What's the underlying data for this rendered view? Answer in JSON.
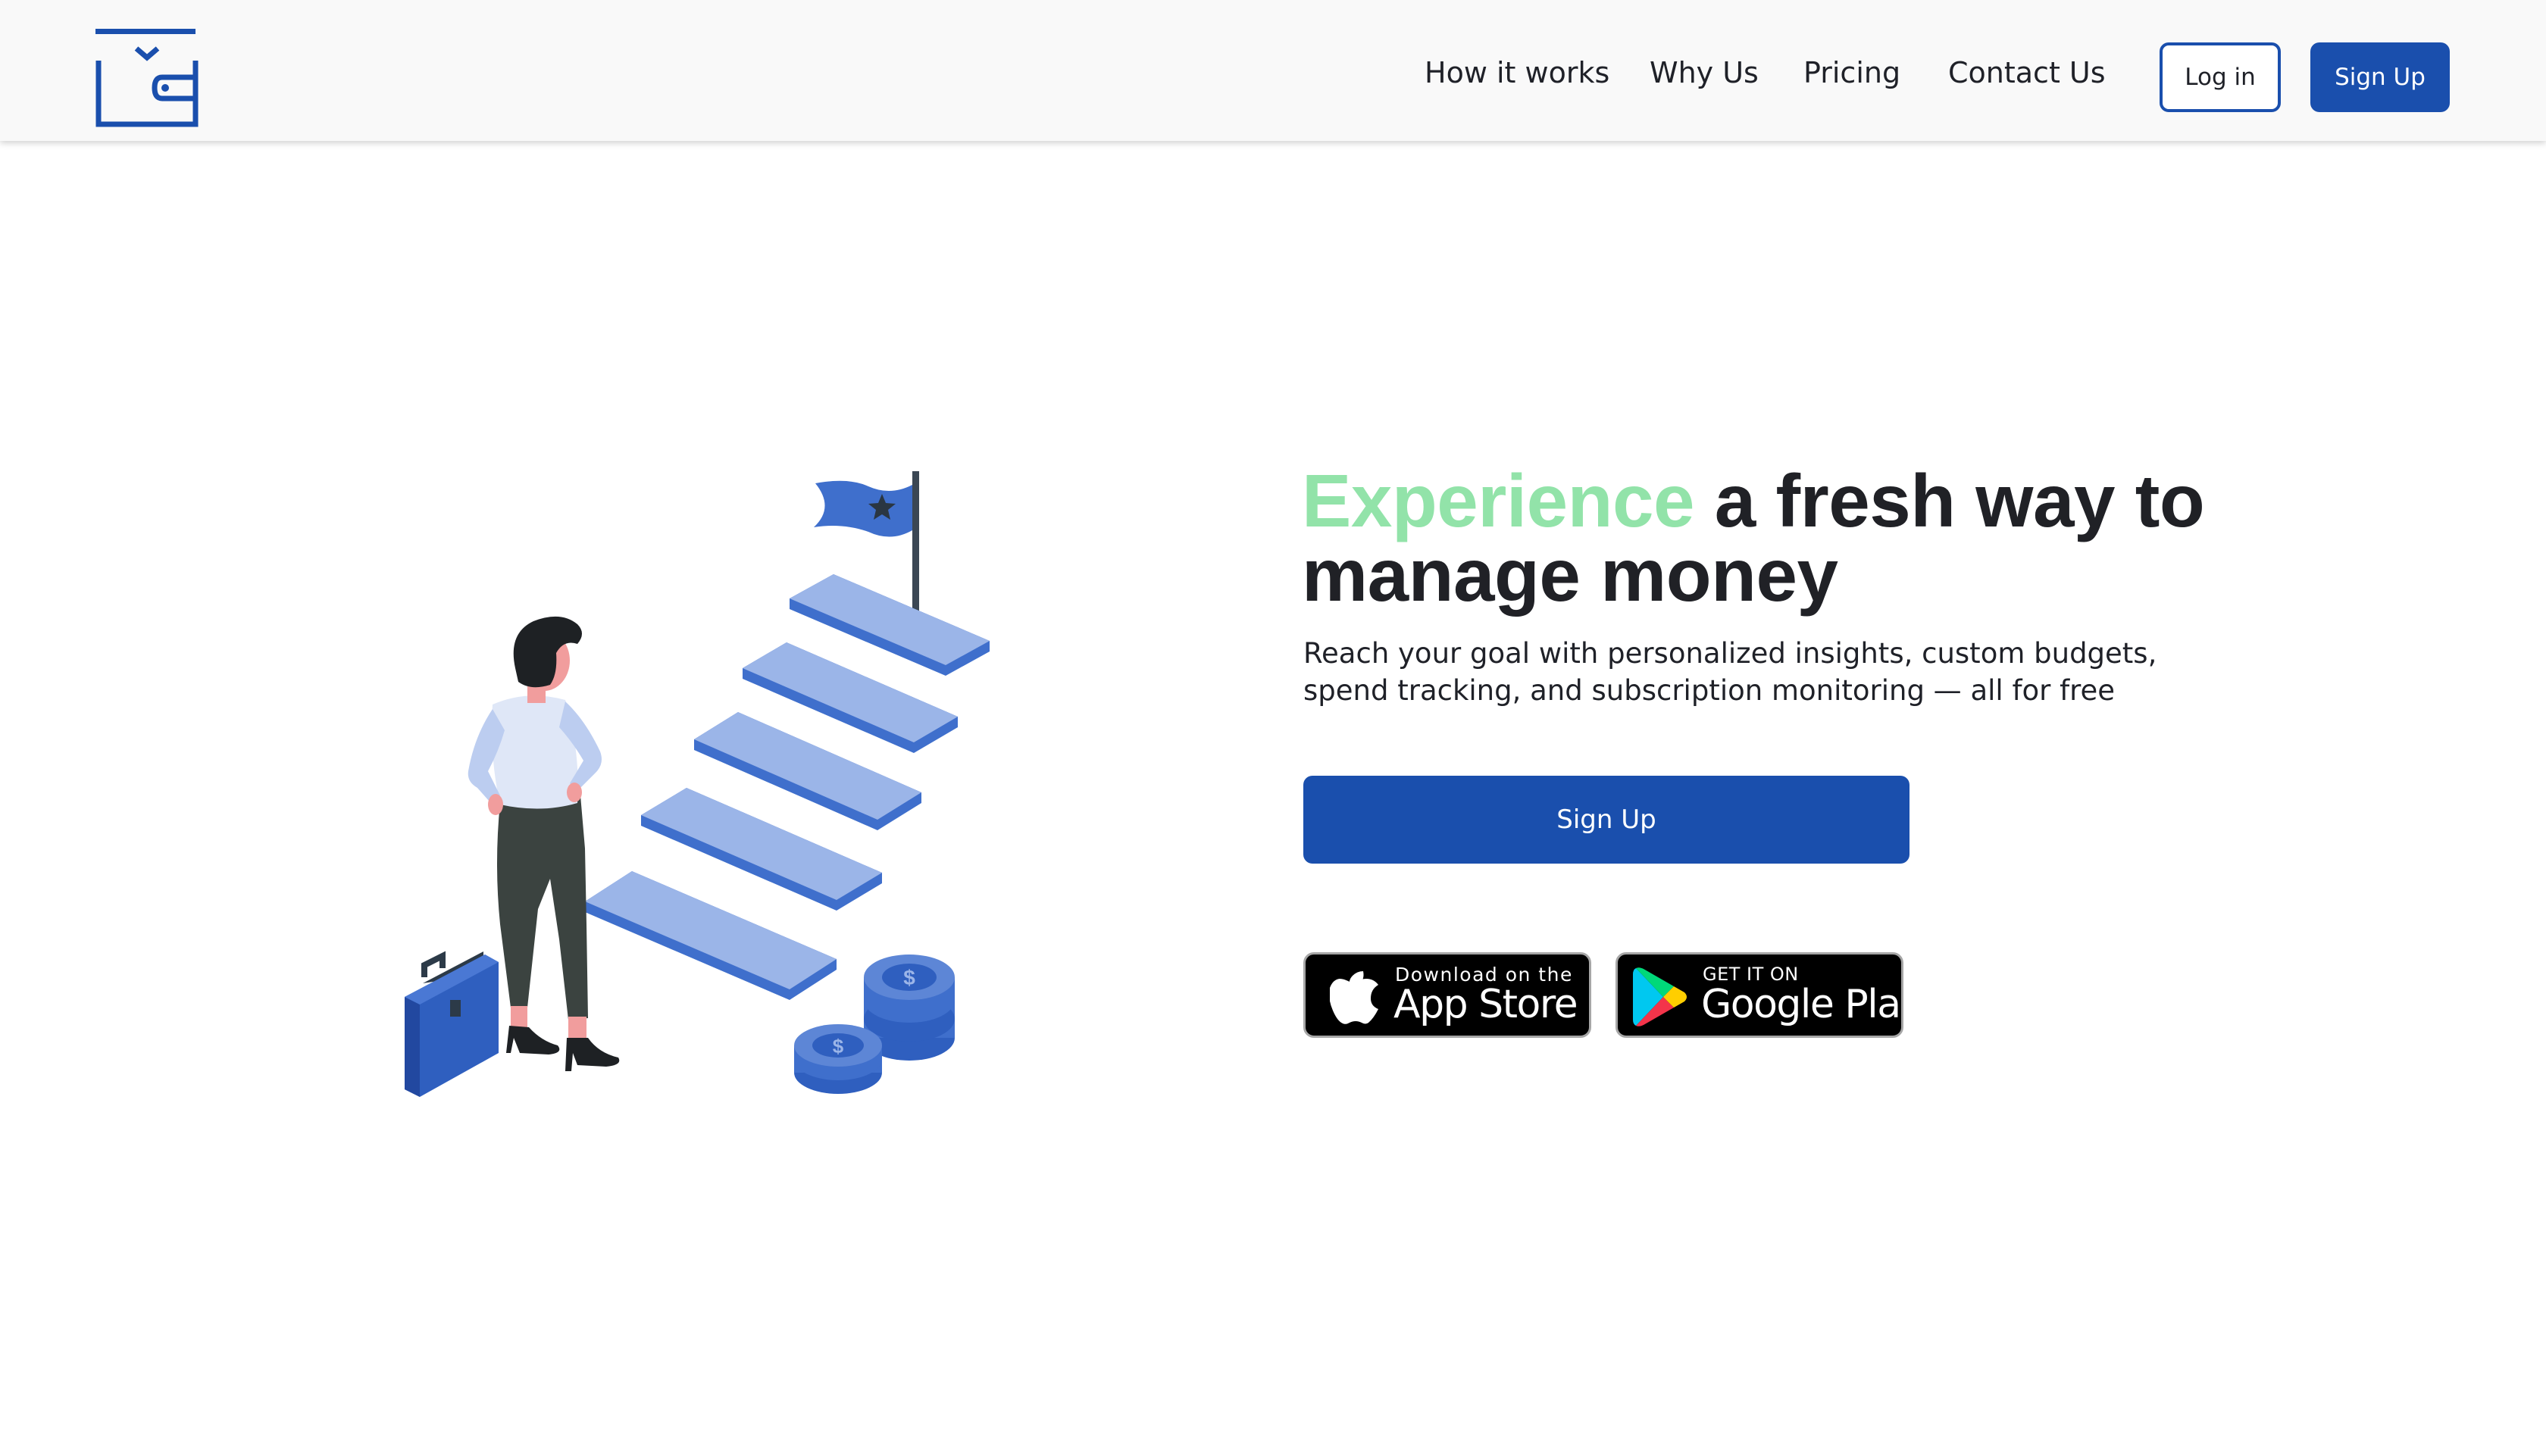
{
  "nav": {
    "links": [
      "How it works",
      "Why Us",
      "Pricing",
      "Contact Us"
    ],
    "login_label": "Log in",
    "signup_label": "Sign Up"
  },
  "hero": {
    "headline_accent": "Experience",
    "headline_rest_line1": " a fresh way to",
    "headline_line2": "manage money",
    "subtitle": "Reach your goal with personalized insights, custom budgets, spend tracking, and subscription monitoring — all for free",
    "cta_label": "Sign Up"
  },
  "store_badges": {
    "apple": {
      "small": "Download on the",
      "large": "App Store",
      "icon": "apple-icon"
    },
    "google": {
      "small": "GET IT ON",
      "large": "Google Play",
      "icon": "google-play-icon"
    }
  },
  "colors": {
    "brand_blue": "#1a4fad",
    "accent_green": "#92e3a9",
    "header_bg": "#f9f9f9",
    "illustration_blue": "#9bb5e8"
  }
}
